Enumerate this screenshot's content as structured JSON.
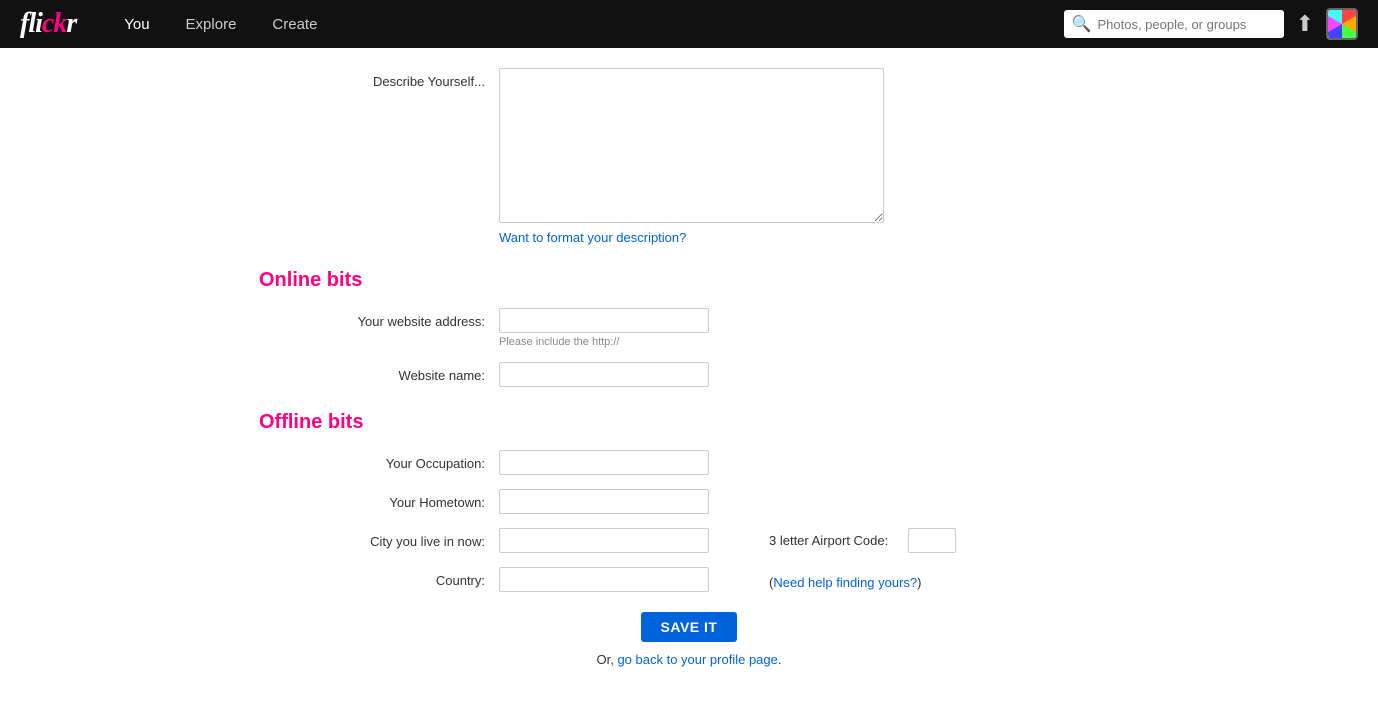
{
  "navbar": {
    "logo": "flickr",
    "links": [
      {
        "label": "You",
        "active": true
      },
      {
        "label": "Explore",
        "active": false
      },
      {
        "label": "Create",
        "active": false
      }
    ],
    "search_placeholder": "Photos, people, or groups"
  },
  "form": {
    "describe_label": "Describe Yourself...",
    "describe_placeholder": "",
    "format_link": "Want to format your description?",
    "online_heading": "Online bits",
    "website_address_label": "Your website address:",
    "website_address_placeholder": "",
    "website_hint": "Please include the http://",
    "website_name_label": "Website name:",
    "website_name_placeholder": "",
    "offline_heading": "Offline bits",
    "occupation_label": "Your Occupation:",
    "occupation_placeholder": "",
    "hometown_label": "Your Hometown:",
    "hometown_placeholder": "",
    "city_label": "City you live in now:",
    "city_placeholder": "",
    "country_label": "Country:",
    "country_placeholder": "",
    "airport_label": "3 letter Airport Code:",
    "airport_placeholder": "",
    "airport_help_prefix": "(",
    "airport_help_link": "Need help finding yours?",
    "airport_help_suffix": ")",
    "save_label": "SAVE IT",
    "back_prefix": "Or, ",
    "back_link": "go back to your profile page",
    "back_suffix": "."
  }
}
